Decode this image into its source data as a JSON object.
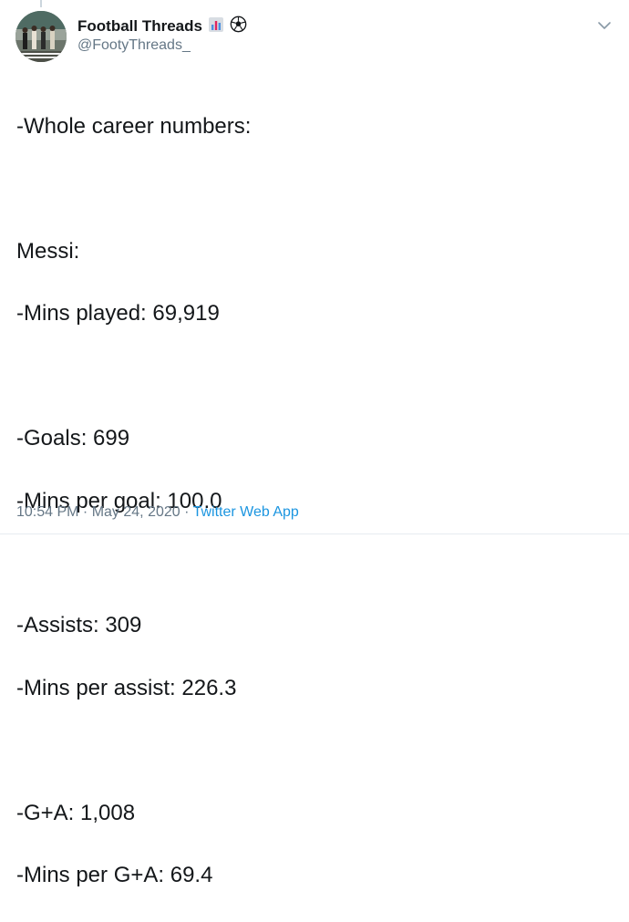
{
  "author": {
    "display_name": "Football Threads",
    "handle": "@FootyThreads_",
    "name_emojis": [
      "chart-icon",
      "soccer-ball-icon"
    ]
  },
  "tweet": {
    "lines": [
      "-Whole career numbers:",
      "",
      "Messi:",
      "-Mins played: 69,919",
      "",
      "-Goals: 699",
      "-Mins per goal: 100.0",
      "",
      "-Assists: 309",
      "-Mins per assist: 226.3",
      "",
      "-G+A: 1,008",
      "-Mins per G+A: 69.4"
    ],
    "timestamp": "10:54 PM · May 24, 2020",
    "separator": " · ",
    "source_app": "Twitter Web App"
  },
  "colors": {
    "text": "#14171a",
    "secondary": "#657786",
    "link": "#1b95e0"
  }
}
